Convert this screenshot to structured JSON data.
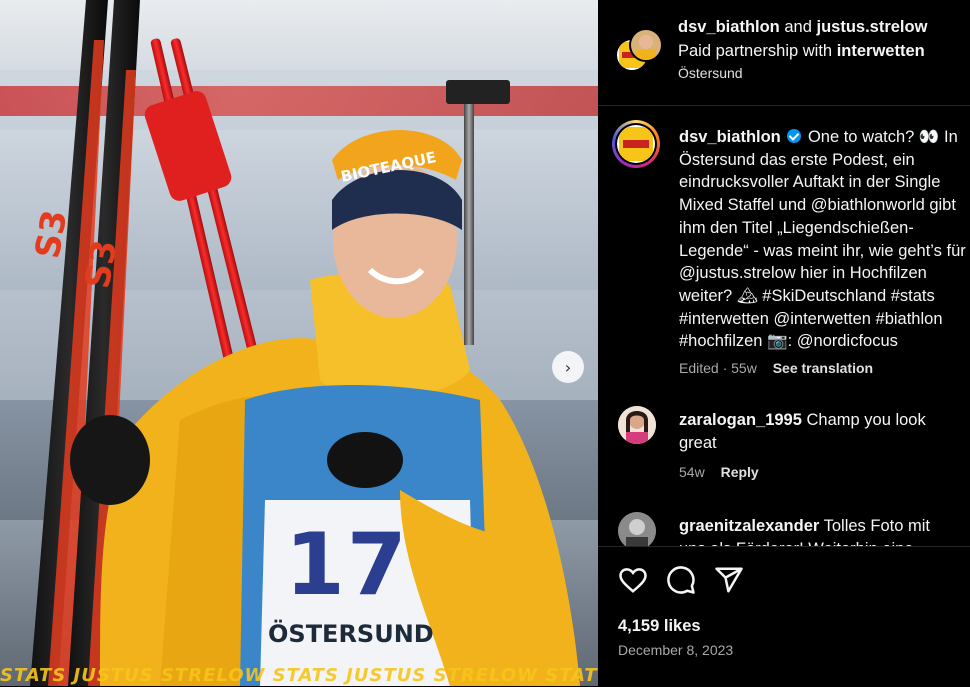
{
  "media": {
    "overlay_text": "STATS JUSTUS STRELOW STATS JUSTUS STRELOW STATS JUSTUS STRELOW",
    "bib_number": "17",
    "bib_text": "ÖSTERSUND",
    "headband_text": "BIOTEAQUE",
    "next_icon": "chevron-right-icon"
  },
  "header": {
    "author1": "dsv_biathlon",
    "and_text": "and",
    "author2": "justus.strelow",
    "partnership_prefix": "Paid partnership with",
    "partner": "interwetten",
    "location": "Östersund"
  },
  "caption": {
    "author": "dsv_biathlon",
    "text": "One to watch? 👀 In Östersund das erste Podest, ein eindrucksvoller Auftakt in der Single Mixed Staffel und @biathlonworld gibt ihm den Titel „Liegendschießen-Legende“ - was meint ihr, wie geht’s für @justus.strelow hier in Hochfilzen weiter? 🏔 #SkiDeutschland #stats #interwetten @interwetten #biathlon #hochfilzen 📷: @nordicfocus",
    "edited": "Edited · 55w",
    "see_translation": "See translation"
  },
  "comments": [
    {
      "user": "zaralogan_1995",
      "text": "Champ you look great",
      "age": "54w",
      "reply": "Reply"
    },
    {
      "user": "graenitzalexander",
      "text": "Tolles Foto mit uns als Förderer! Weiterhin eine"
    }
  ],
  "actions": {
    "like_icon": "heart-icon",
    "comment_icon": "comment-icon",
    "share_icon": "share-icon",
    "likes": "4,159 likes",
    "date": "December 8, 2023"
  },
  "colors": {
    "background": "#000000",
    "text": "#f5f5f5",
    "muted": "#a8a8a8",
    "verified": "#0095f6",
    "jacket": "#f2b21c",
    "ski_red": "#e33b1e"
  }
}
